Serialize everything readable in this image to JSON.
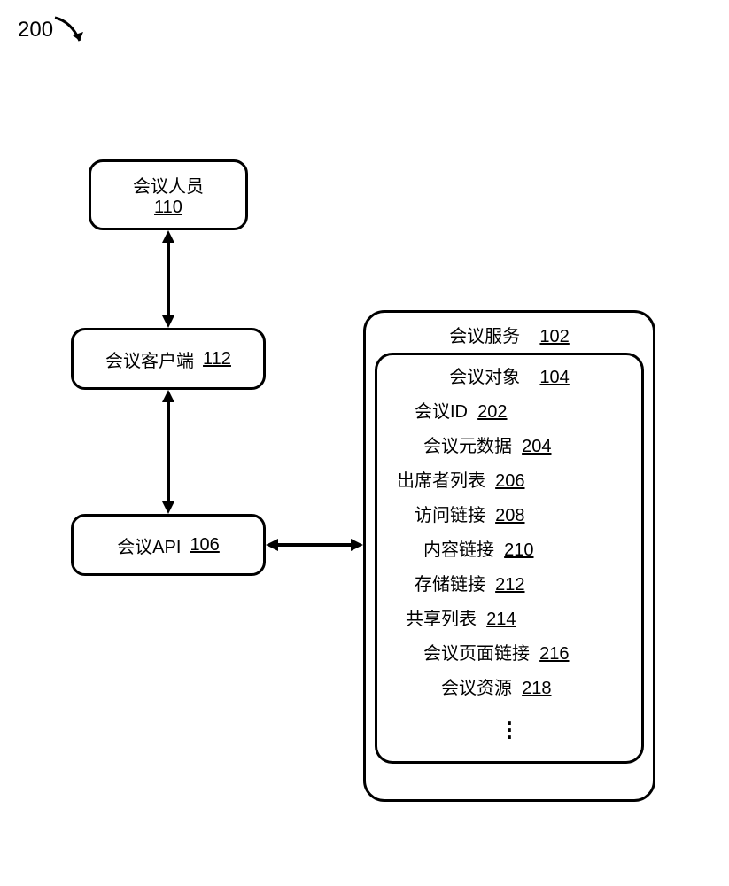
{
  "figure": {
    "number": "200"
  },
  "boxes": {
    "attendee": {
      "label": "会议人员",
      "ref": "110"
    },
    "client": {
      "label": "会议客户端",
      "ref": "112"
    },
    "api": {
      "label": "会议API",
      "ref": "106"
    }
  },
  "service": {
    "label": "会议服务",
    "ref": "102",
    "object": {
      "label": "会议对象",
      "ref": "104",
      "attrs": [
        {
          "label": "会议ID",
          "ref": "202",
          "indent": 20
        },
        {
          "label": "会议元数据",
          "ref": "204",
          "indent": 30
        },
        {
          "label": "出席者列表",
          "ref": "206",
          "indent": 0
        },
        {
          "label": "访问链接",
          "ref": "208",
          "indent": 20
        },
        {
          "label": "内容链接",
          "ref": "210",
          "indent": 30
        },
        {
          "label": "存储链接",
          "ref": "212",
          "indent": 20
        },
        {
          "label": "共享列表",
          "ref": "214",
          "indent": 10
        },
        {
          "label": "会议页面链接",
          "ref": "216",
          "indent": 30
        },
        {
          "label": "会议资源",
          "ref": "218",
          "indent": 50
        }
      ]
    }
  }
}
